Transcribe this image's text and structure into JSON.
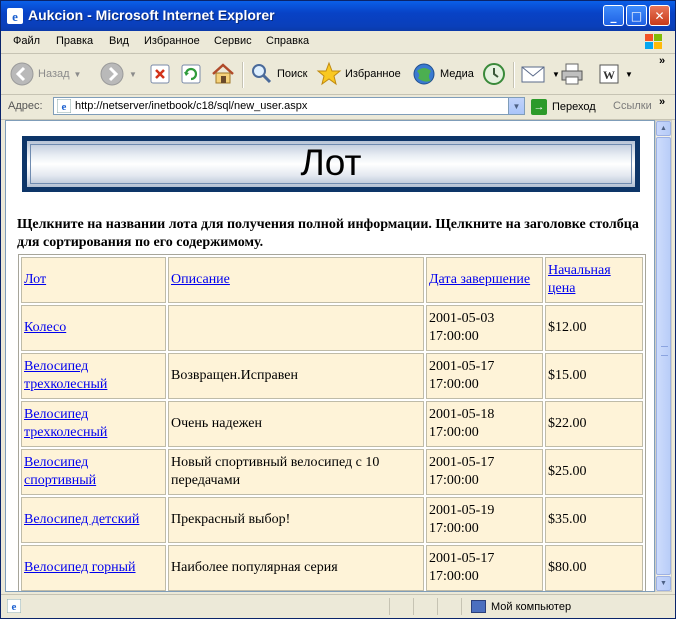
{
  "window": {
    "title": "Aukcion - Microsoft Internet Explorer"
  },
  "menu": [
    "Файл",
    "Правка",
    "Вид",
    "Избранное",
    "Сервис",
    "Справка"
  ],
  "toolbar": {
    "back": "Назад",
    "search": "Поиск",
    "favorites": "Избранное",
    "media": "Медиа"
  },
  "address": {
    "label": "Адрес:",
    "url": "http://netserver/inetbook/c18/sql/new_user.aspx",
    "go": "Переход",
    "links": "Ссылки"
  },
  "page": {
    "banner_title": "Лот",
    "instructions": "Щелкните на названии лота для получения полной информации. Щелкните на заголовке столбца для сортирования по его содержимому.",
    "columns": [
      "Лот",
      "Описание",
      "Дата завершение",
      "Начальная цена"
    ],
    "rows": [
      {
        "name": "Колесо",
        "description": "",
        "end_date": "2001-05-03 17:00:00",
        "price": "$12.00"
      },
      {
        "name": "Велосипед трехколесный",
        "description": "Возвращен.Исправен",
        "end_date": "2001-05-17 17:00:00",
        "price": "$15.00"
      },
      {
        "name": "Велосипед трехколесный",
        "description": "Очень надежен",
        "end_date": "2001-05-18 17:00:00",
        "price": "$22.00"
      },
      {
        "name": "Велосипед спортивный",
        "description": "Новый спортивный велосипед с 10 передачами",
        "end_date": "2001-05-17 17:00:00",
        "price": "$25.00"
      },
      {
        "name": "Велосипед детский",
        "description": "Прекрасный выбор!",
        "end_date": "2001-05-19 17:00:00",
        "price": "$35.00"
      },
      {
        "name": "Велосипед горный",
        "description": "Наиболее популярная серия",
        "end_date": "2001-05-17 17:00:00",
        "price": "$80.00"
      }
    ]
  },
  "status": {
    "zone": "Мой компьютер"
  },
  "icons": [
    "ie-icon",
    "minimize-icon",
    "maximize-icon",
    "close-icon",
    "windows-logo-icon",
    "back-icon",
    "forward-icon",
    "stop-icon",
    "refresh-icon",
    "home-icon",
    "search-icon",
    "favorites-star-icon",
    "media-icon",
    "history-icon",
    "mail-icon",
    "print-icon",
    "word-icon",
    "go-arrow-icon",
    "computer-icon"
  ],
  "colors": {
    "titlebar": "#0a5fe8",
    "table_cell": "#fef3d8",
    "link": "#0000ee",
    "banner_border": "#0d3568"
  }
}
